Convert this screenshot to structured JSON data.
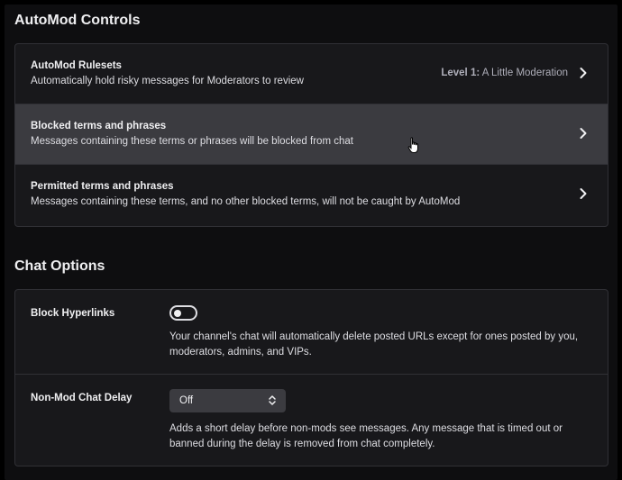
{
  "automod": {
    "section_title": "AutoMod Controls",
    "rows": [
      {
        "title": "AutoMod Rulesets",
        "description": "Automatically hold risky messages for Moderators to review",
        "value_level": "Level 1:",
        "value_name": "A Little Moderation"
      },
      {
        "title": "Blocked terms and phrases",
        "description": "Messages containing these terms or phrases will be blocked from chat"
      },
      {
        "title": "Permitted terms and phrases",
        "description": "Messages containing these terms, and no other blocked terms, will not be caught by AutoMod"
      }
    ]
  },
  "chat_options": {
    "section_title": "Chat Options",
    "block_hyperlinks": {
      "label": "Block Hyperlinks",
      "enabled": false,
      "help": "Your channel's chat will automatically delete posted URLs except for ones posted by you, moderators, admins, and VIPs."
    },
    "non_mod_delay": {
      "label": "Non-Mod Chat Delay",
      "selected": "Off",
      "help": "Adds a short delay before non-mods see messages. Any message that is timed out or banned during the delay is removed from chat completely."
    }
  },
  "colors": {
    "background": "#0e0e10",
    "card": "#18181b",
    "hover_row": "#3b3b40",
    "border": "#303035",
    "text_primary": "#efeff1",
    "text_secondary": "#adadb8"
  },
  "icons": {
    "row_chevron": "chevron-right-icon",
    "select_arrows": "updown-arrows-icon",
    "cursor": "hand-pointer-icon"
  }
}
